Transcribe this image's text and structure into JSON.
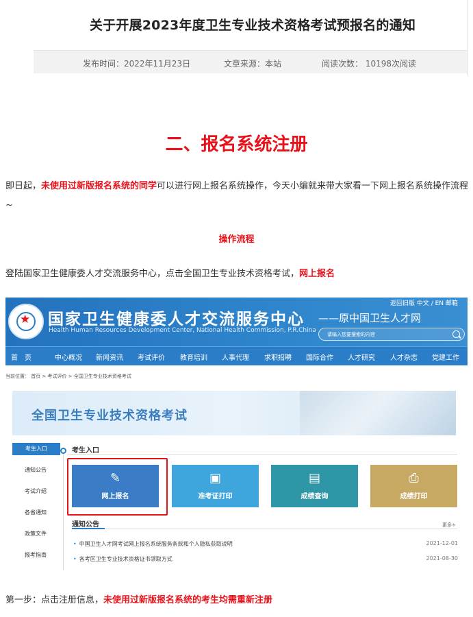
{
  "article": {
    "title": "关于开展2023年度卫生专业技术资格考试预报名的通知",
    "meta": {
      "publish_time": "发布时间：2022年11月23日",
      "source": "文章来源：本站",
      "views": "阅读次数：  10198次阅读"
    },
    "section_title": "二、报名系统注册",
    "intro": {
      "part1": "即日起，",
      "highlight": "未使用过新版报名系统的同学",
      "part2": "可以进行网上报名系统操作，今天小编就来带大家看一下网上报名系统操作流程~"
    },
    "sub_title": "操作流程",
    "login_text": {
      "part1": "登陆国家卫生健康委人才交流服务中心，点击全国卫生专业技术资格考试，",
      "highlight": "网上报名"
    },
    "step1": {
      "part1": "第一步：点击注册信息，",
      "highlight": "未使用过新版报名系统的考生均需重新注册"
    }
  },
  "site": {
    "name": "国家卫生健康委人才交流服务中心",
    "english": "Health Human Resources Development Center, National Health Commission, P.R.China",
    "former": "——原中国卫生人才网",
    "top_links": "返回旧版  中文 / EN   邮箱",
    "search_placeholder": "请输入您要搜索的内容",
    "nav": [
      "首　页",
      "中心概况",
      "新闻资讯",
      "考试评价",
      "教育培训",
      "人事代理",
      "求职招聘",
      "国际合作",
      "人才研究",
      "人才杂志",
      "党建工作"
    ],
    "breadcrumb": "当前位置： 首页 > 考试评价 > 全国卫生专业技术资格考试",
    "banner_title": "全国卫生专业技术资格考试",
    "side_nav": [
      "考生入口",
      "通知公告",
      "考试介绍",
      "各省通知",
      "政策文件",
      "报考指南"
    ],
    "section_head": "考生入口",
    "tiles": [
      {
        "label": "网上报名",
        "icon": "pencil-icon"
      },
      {
        "label": "准考证打印",
        "icon": "id-card-icon"
      },
      {
        "label": "成绩查询",
        "icon": "document-search-icon"
      },
      {
        "label": "成绩打印",
        "icon": "printer-icon"
      }
    ],
    "notice_head": "通知公告",
    "notice_more": "更多+",
    "notices": [
      {
        "text": "中国卫生人才网考试网上报名系统服务条款和个人隐私获取说明",
        "date": "2021-12-01"
      },
      {
        "text": "各考区卫生专业技术资格证书领取方式",
        "date": "2021-08-30"
      }
    ]
  },
  "colors": {
    "accent_red": "#e8121b",
    "site_blue": "#2a7dc6"
  }
}
